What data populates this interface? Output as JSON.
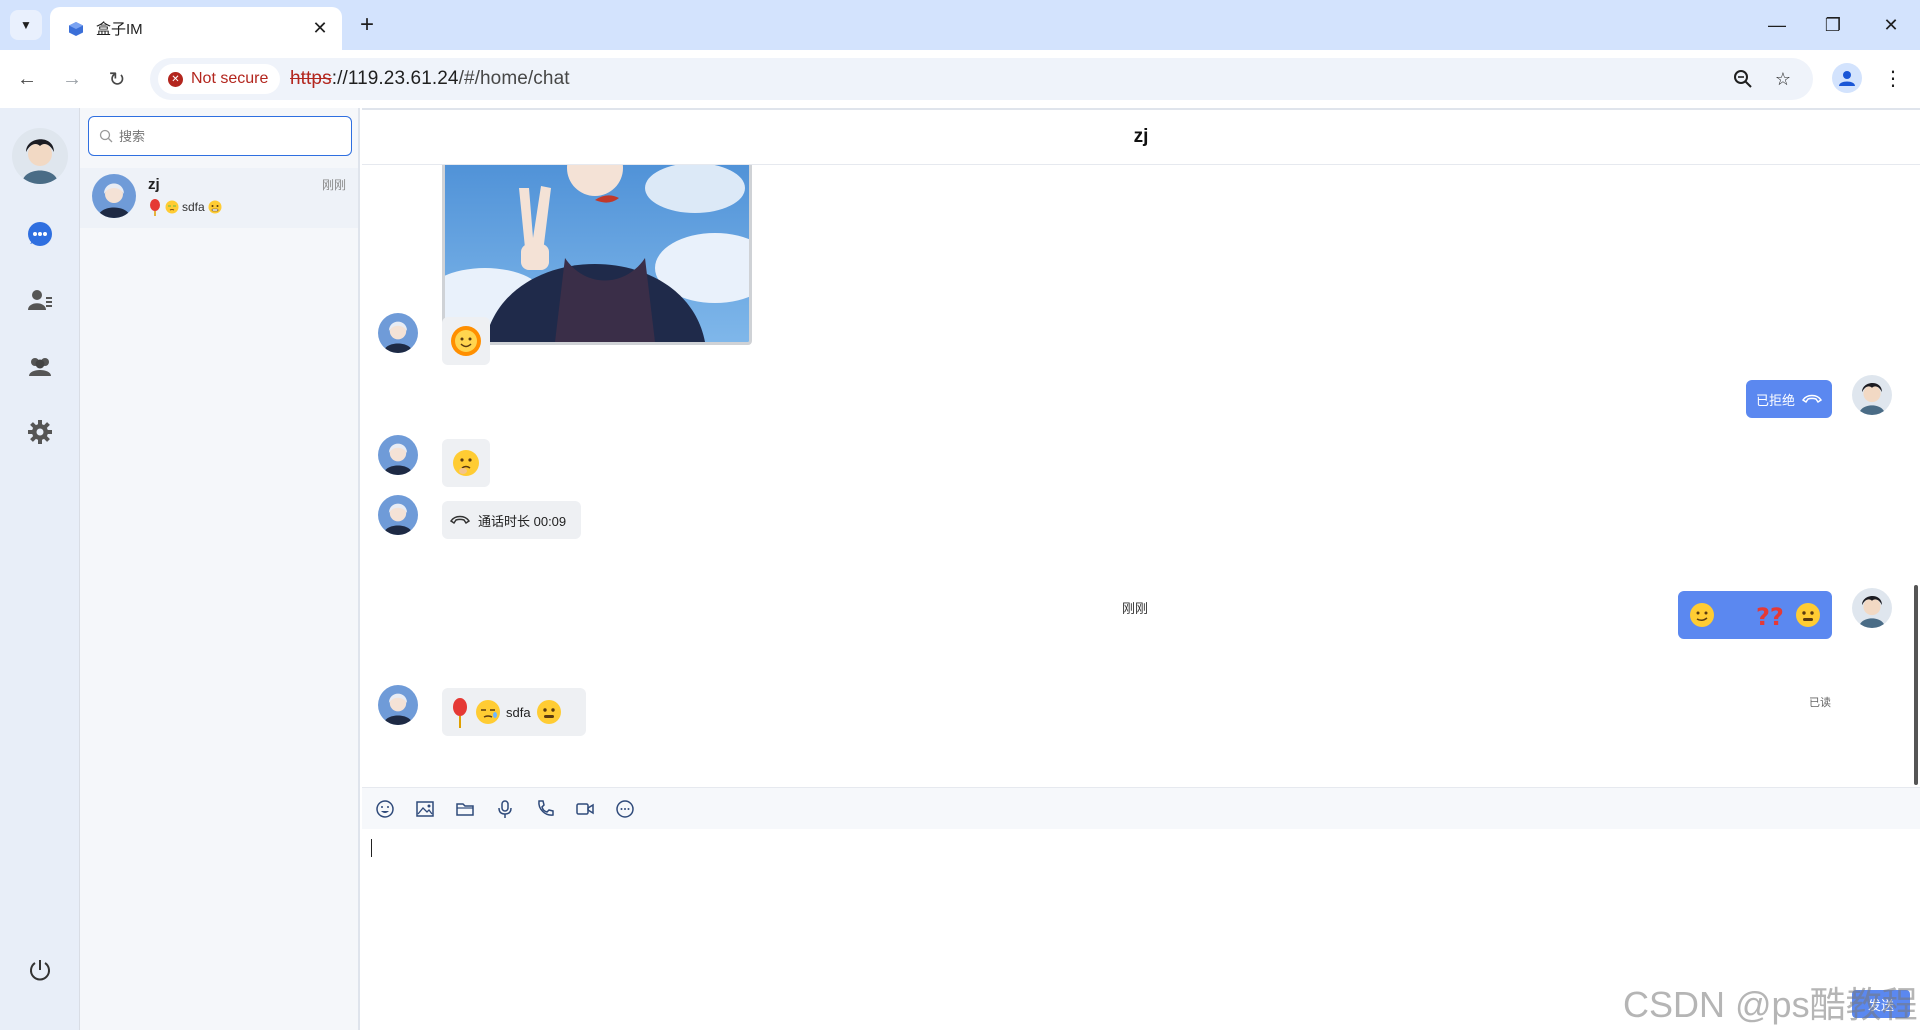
{
  "browser": {
    "tab_title": "盒子IM",
    "security_label": "Not secure",
    "url_scheme": "https",
    "url_host": "://119.23.61.24",
    "url_path": "/#/home/chat"
  },
  "search": {
    "placeholder": "搜索"
  },
  "conversation": {
    "name": "zj",
    "time": "刚刚",
    "preview_text": "sdfa"
  },
  "chat": {
    "title": "zj",
    "messages": {
      "rejected_call_label": "已拒绝",
      "call_duration_label": "通话时长 00:09",
      "time_divider": "刚刚",
      "read_receipt": "已读",
      "last_text": "sdfa"
    },
    "send_label": "发送"
  },
  "watermark": "CSDN @ps酷教程",
  "colors": {
    "accent": "#5b88f0",
    "rail_bg": "#e8eef8",
    "tabstrip_bg": "#d3e3fd",
    "danger": "#b3261e"
  }
}
